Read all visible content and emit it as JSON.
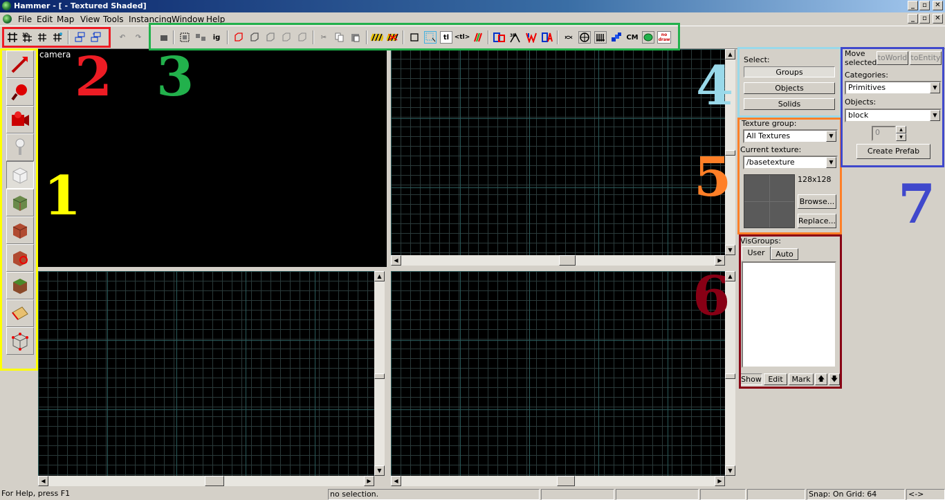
{
  "window": {
    "title": "Hammer - [ - Textured Shaded]",
    "btn_min": "_",
    "btn_max": "▫",
    "btn_close": "✕"
  },
  "menu": [
    "File",
    "Edit",
    "Map",
    "View",
    "Tools",
    "Instancing",
    "Window",
    "Help"
  ],
  "toolbar": {
    "labels": {
      "ig": "ig",
      "cm": "CM",
      "nodraw_top": "no",
      "nodraw_bottom": "draw"
    }
  },
  "annotations": [
    {
      "num": "1",
      "color": "#ffff00"
    },
    {
      "num": "2",
      "color": "#ed1c24"
    },
    {
      "num": "3",
      "color": "#22b14c"
    },
    {
      "num": "4",
      "color": "#99d9ea"
    },
    {
      "num": "5",
      "color": "#ff7f27"
    },
    {
      "num": "6",
      "color": "#880015"
    },
    {
      "num": "7",
      "color": "#3f48cc"
    }
  ],
  "viewports": {
    "camera_label": "camera"
  },
  "select_panel": {
    "title": "Select:",
    "groups": "Groups",
    "objects": "Objects",
    "solids": "Solids"
  },
  "texture_panel": {
    "group_label": "Texture group:",
    "group_value": "All Textures",
    "current_label": "Current texture:",
    "current_value": "/basetexture",
    "size": "128x128",
    "browse": "Browse...",
    "replace": "Replace..."
  },
  "visgroups": {
    "title": "VisGroups:",
    "tab_user": "User",
    "tab_auto": "Auto",
    "show": "Show",
    "edit": "Edit",
    "mark": "Mark",
    "up": "🡅",
    "down": "🡇"
  },
  "objects_panel": {
    "move_selected": "Move selected:",
    "to_world": "toWorld",
    "to_entity": "toEntity",
    "categories_label": "Categories:",
    "categories_value": "Primitives",
    "objects_label": "Objects:",
    "objects_value": "block",
    "spinner": "0",
    "create_prefab": "Create Prefab"
  },
  "status": {
    "help": "For Help, press F1",
    "selection": "no selection.",
    "snap": "Snap: On Grid: 64",
    "arrows": "<->"
  }
}
